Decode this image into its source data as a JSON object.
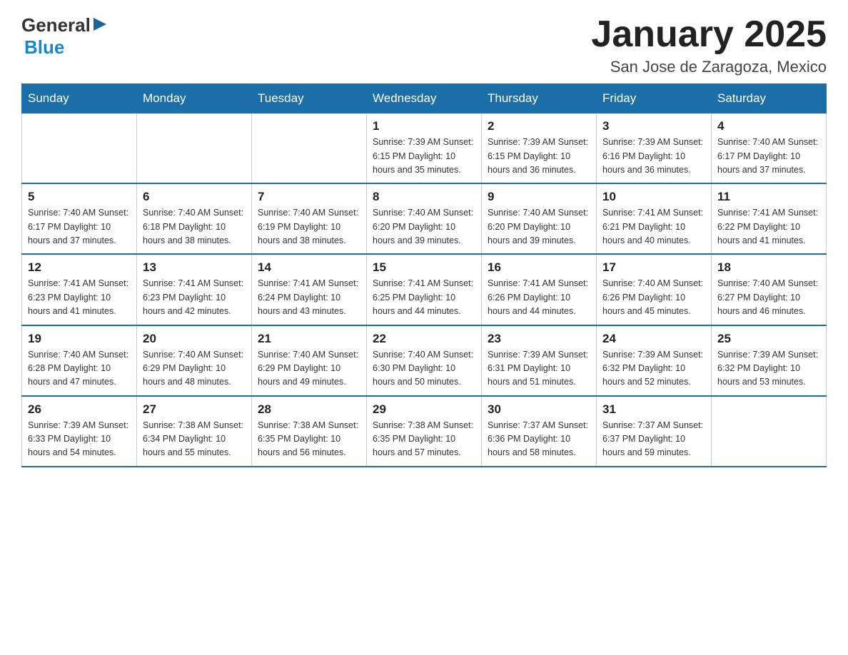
{
  "header": {
    "logo_general": "General",
    "logo_blue": "Blue",
    "month_title": "January 2025",
    "location": "San Jose de Zaragoza, Mexico"
  },
  "weekdays": [
    "Sunday",
    "Monday",
    "Tuesday",
    "Wednesday",
    "Thursday",
    "Friday",
    "Saturday"
  ],
  "weeks": [
    [
      {
        "day": "",
        "info": ""
      },
      {
        "day": "",
        "info": ""
      },
      {
        "day": "",
        "info": ""
      },
      {
        "day": "1",
        "info": "Sunrise: 7:39 AM\nSunset: 6:15 PM\nDaylight: 10 hours\nand 35 minutes."
      },
      {
        "day": "2",
        "info": "Sunrise: 7:39 AM\nSunset: 6:15 PM\nDaylight: 10 hours\nand 36 minutes."
      },
      {
        "day": "3",
        "info": "Sunrise: 7:39 AM\nSunset: 6:16 PM\nDaylight: 10 hours\nand 36 minutes."
      },
      {
        "day": "4",
        "info": "Sunrise: 7:40 AM\nSunset: 6:17 PM\nDaylight: 10 hours\nand 37 minutes."
      }
    ],
    [
      {
        "day": "5",
        "info": "Sunrise: 7:40 AM\nSunset: 6:17 PM\nDaylight: 10 hours\nand 37 minutes."
      },
      {
        "day": "6",
        "info": "Sunrise: 7:40 AM\nSunset: 6:18 PM\nDaylight: 10 hours\nand 38 minutes."
      },
      {
        "day": "7",
        "info": "Sunrise: 7:40 AM\nSunset: 6:19 PM\nDaylight: 10 hours\nand 38 minutes."
      },
      {
        "day": "8",
        "info": "Sunrise: 7:40 AM\nSunset: 6:20 PM\nDaylight: 10 hours\nand 39 minutes."
      },
      {
        "day": "9",
        "info": "Sunrise: 7:40 AM\nSunset: 6:20 PM\nDaylight: 10 hours\nand 39 minutes."
      },
      {
        "day": "10",
        "info": "Sunrise: 7:41 AM\nSunset: 6:21 PM\nDaylight: 10 hours\nand 40 minutes."
      },
      {
        "day": "11",
        "info": "Sunrise: 7:41 AM\nSunset: 6:22 PM\nDaylight: 10 hours\nand 41 minutes."
      }
    ],
    [
      {
        "day": "12",
        "info": "Sunrise: 7:41 AM\nSunset: 6:23 PM\nDaylight: 10 hours\nand 41 minutes."
      },
      {
        "day": "13",
        "info": "Sunrise: 7:41 AM\nSunset: 6:23 PM\nDaylight: 10 hours\nand 42 minutes."
      },
      {
        "day": "14",
        "info": "Sunrise: 7:41 AM\nSunset: 6:24 PM\nDaylight: 10 hours\nand 43 minutes."
      },
      {
        "day": "15",
        "info": "Sunrise: 7:41 AM\nSunset: 6:25 PM\nDaylight: 10 hours\nand 44 minutes."
      },
      {
        "day": "16",
        "info": "Sunrise: 7:41 AM\nSunset: 6:26 PM\nDaylight: 10 hours\nand 44 minutes."
      },
      {
        "day": "17",
        "info": "Sunrise: 7:40 AM\nSunset: 6:26 PM\nDaylight: 10 hours\nand 45 minutes."
      },
      {
        "day": "18",
        "info": "Sunrise: 7:40 AM\nSunset: 6:27 PM\nDaylight: 10 hours\nand 46 minutes."
      }
    ],
    [
      {
        "day": "19",
        "info": "Sunrise: 7:40 AM\nSunset: 6:28 PM\nDaylight: 10 hours\nand 47 minutes."
      },
      {
        "day": "20",
        "info": "Sunrise: 7:40 AM\nSunset: 6:29 PM\nDaylight: 10 hours\nand 48 minutes."
      },
      {
        "day": "21",
        "info": "Sunrise: 7:40 AM\nSunset: 6:29 PM\nDaylight: 10 hours\nand 49 minutes."
      },
      {
        "day": "22",
        "info": "Sunrise: 7:40 AM\nSunset: 6:30 PM\nDaylight: 10 hours\nand 50 minutes."
      },
      {
        "day": "23",
        "info": "Sunrise: 7:39 AM\nSunset: 6:31 PM\nDaylight: 10 hours\nand 51 minutes."
      },
      {
        "day": "24",
        "info": "Sunrise: 7:39 AM\nSunset: 6:32 PM\nDaylight: 10 hours\nand 52 minutes."
      },
      {
        "day": "25",
        "info": "Sunrise: 7:39 AM\nSunset: 6:32 PM\nDaylight: 10 hours\nand 53 minutes."
      }
    ],
    [
      {
        "day": "26",
        "info": "Sunrise: 7:39 AM\nSunset: 6:33 PM\nDaylight: 10 hours\nand 54 minutes."
      },
      {
        "day": "27",
        "info": "Sunrise: 7:38 AM\nSunset: 6:34 PM\nDaylight: 10 hours\nand 55 minutes."
      },
      {
        "day": "28",
        "info": "Sunrise: 7:38 AM\nSunset: 6:35 PM\nDaylight: 10 hours\nand 56 minutes."
      },
      {
        "day": "29",
        "info": "Sunrise: 7:38 AM\nSunset: 6:35 PM\nDaylight: 10 hours\nand 57 minutes."
      },
      {
        "day": "30",
        "info": "Sunrise: 7:37 AM\nSunset: 6:36 PM\nDaylight: 10 hours\nand 58 minutes."
      },
      {
        "day": "31",
        "info": "Sunrise: 7:37 AM\nSunset: 6:37 PM\nDaylight: 10 hours\nand 59 minutes."
      },
      {
        "day": "",
        "info": ""
      }
    ]
  ]
}
